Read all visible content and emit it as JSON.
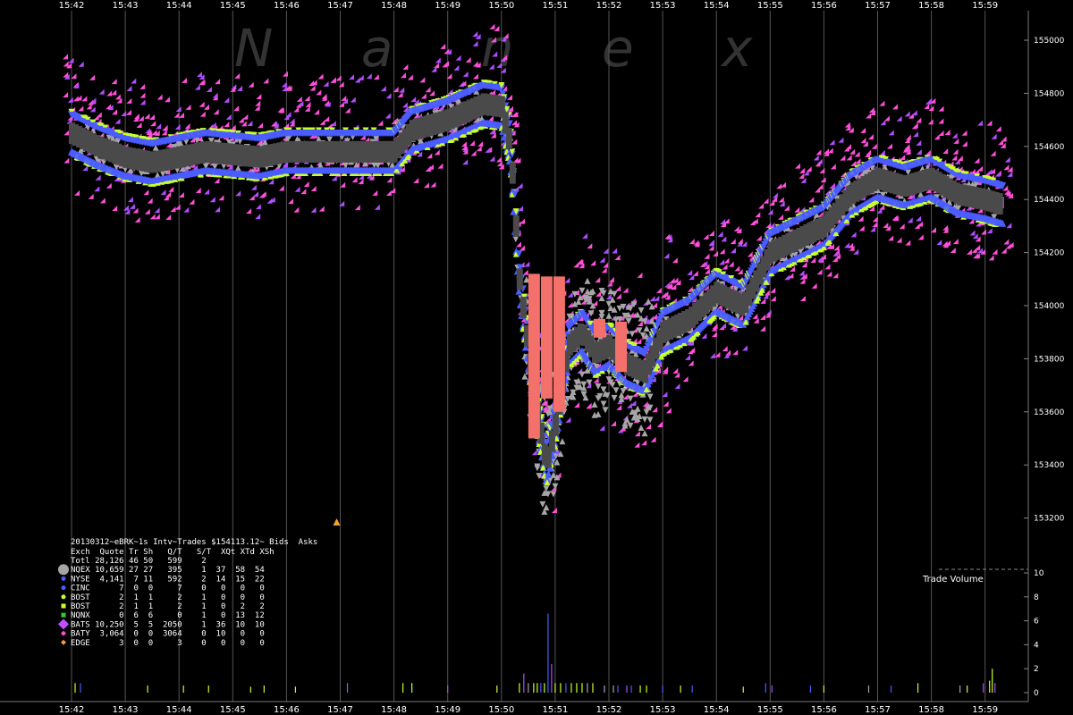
{
  "watermark": "N a n e x",
  "chart_data": [
    {
      "type": "scatter",
      "title": "20130312~eBRK~1s Intv~Trades $154113.12~ Bids  Asks",
      "x_ticks": [
        "15:42",
        "15:43",
        "15:44",
        "15:45",
        "15:46",
        "15:47",
        "15:48",
        "15:49",
        "15:50",
        "15:51",
        "15:52",
        "15:53",
        "15:54",
        "15:55",
        "15:56",
        "15:57",
        "15:58",
        "15:59"
      ],
      "y_ticks": [
        "155000",
        "154800",
        "154600",
        "154400",
        "154200",
        "154000",
        "153800",
        "153600",
        "153400",
        "153200"
      ],
      "ylim": [
        153050,
        155050
      ],
      "grid": true,
      "series_colors": {
        "nqex": "#a6a6a6",
        "nyse": "#4a5cff",
        "bats": "#ff4fd8",
        "baty": "#b04dff",
        "bost": "#c8ff2e",
        "trades": "#4a4a4a",
        "large_trade": "#f4706a",
        "edge": "#f0a030"
      },
      "bid_path": [
        [
          "15:42:00",
          154650
        ],
        [
          "15:42:30",
          154600
        ],
        [
          "15:43:00",
          154560
        ],
        [
          "15:43:30",
          154540
        ],
        [
          "15:44:00",
          154560
        ],
        [
          "15:44:30",
          154580
        ],
        [
          "15:45:00",
          154570
        ],
        [
          "15:45:30",
          154560
        ],
        [
          "15:46:00",
          154580
        ],
        [
          "15:47:00",
          154580
        ],
        [
          "15:48:00",
          154580
        ],
        [
          "15:48:20",
          154660
        ],
        [
          "15:49:00",
          154700
        ],
        [
          "15:49:40",
          154760
        ],
        [
          "15:50:00",
          154750
        ],
        [
          "15:50:10",
          154600
        ],
        [
          "15:50:20",
          154100
        ],
        [
          "15:50:35",
          153700
        ],
        [
          "15:50:50",
          153400
        ],
        [
          "15:51:00",
          153550
        ],
        [
          "15:51:15",
          153850
        ],
        [
          "15:51:30",
          153900
        ],
        [
          "15:51:45",
          153820
        ],
        [
          "15:52:00",
          153850
        ],
        [
          "15:52:20",
          153780
        ],
        [
          "15:52:40",
          153750
        ],
        [
          "15:53:00",
          153900
        ],
        [
          "15:53:30",
          153950
        ],
        [
          "15:54:00",
          154050
        ],
        [
          "15:54:30",
          154000
        ],
        [
          "15:55:00",
          154200
        ],
        [
          "15:55:30",
          154250
        ],
        [
          "15:56:00",
          154300
        ],
        [
          "15:56:30",
          154420
        ],
        [
          "15:57:00",
          154480
        ],
        [
          "15:57:30",
          154450
        ],
        [
          "15:58:00",
          154480
        ],
        [
          "15:58:30",
          154420
        ],
        [
          "15:59:00",
          154400
        ],
        [
          "15:59:20",
          154380
        ]
      ],
      "large_trades": [
        {
          "x": "15:50:36",
          "high": 154120,
          "low": 153500
        },
        {
          "x": "15:50:50",
          "high": 154110,
          "low": 153650
        },
        {
          "x": "15:51:04",
          "high": 154110,
          "low": 153600
        },
        {
          "x": "15:51:49",
          "high": 153950,
          "low": 153880
        },
        {
          "x": "15:52:13",
          "high": 153940,
          "low": 153750
        }
      ]
    },
    {
      "type": "bar",
      "title": "Trade Volume",
      "y_ticks": [
        "0",
        "2",
        "4",
        "6",
        "8",
        "10"
      ],
      "ylim": [
        0,
        10
      ],
      "bars": [
        {
          "x": "15:42:04",
          "v": 0.8,
          "c": "#c8ff2e"
        },
        {
          "x": "15:42:10",
          "v": 0.8,
          "c": "#4a5cff"
        },
        {
          "x": "15:43:25",
          "v": 0.6,
          "c": "#c8ff2e"
        },
        {
          "x": "15:44:05",
          "v": 0.6,
          "c": "#c8ff2e"
        },
        {
          "x": "15:44:33",
          "v": 0.6,
          "c": "#c8ff2e"
        },
        {
          "x": "15:45:20",
          "v": 0.5,
          "c": "#c8ff2e"
        },
        {
          "x": "15:45:35",
          "v": 0.6,
          "c": "#c8ff2e"
        },
        {
          "x": "15:46:10",
          "v": 0.5,
          "c": "#c8ff2e"
        },
        {
          "x": "15:47:08",
          "v": 0.8,
          "c": "#b04dff"
        },
        {
          "x": "15:48:10",
          "v": 0.8,
          "c": "#c8ff2e"
        },
        {
          "x": "15:48:20",
          "v": 0.8,
          "c": "#c8ff2e"
        },
        {
          "x": "15:49:00",
          "v": 0.6,
          "c": "#b04dff"
        },
        {
          "x": "15:49:55",
          "v": 0.6,
          "c": "#c8ff2e"
        },
        {
          "x": "15:50:20",
          "v": 0.8,
          "c": "#c8ff2e"
        },
        {
          "x": "15:50:25",
          "v": 1.6,
          "c": "#b04dff"
        },
        {
          "x": "15:50:30",
          "v": 0.8,
          "c": "#a6a6a6"
        },
        {
          "x": "15:50:36",
          "v": 0.8,
          "c": "#c8ff2e"
        },
        {
          "x": "15:50:40",
          "v": 0.8,
          "c": "#c8ff2e"
        },
        {
          "x": "15:50:44",
          "v": 0.8,
          "c": "#4a5cff"
        },
        {
          "x": "15:50:48",
          "v": 0.8,
          "c": "#c8ff2e"
        },
        {
          "x": "15:50:52",
          "v": 6.6,
          "c": "#4a5cff"
        },
        {
          "x": "15:50:56",
          "v": 2.4,
          "c": "#b04dff"
        },
        {
          "x": "15:51:00",
          "v": 0.8,
          "c": "#c8ff2e"
        },
        {
          "x": "15:51:06",
          "v": 0.8,
          "c": "#c8ff2e"
        },
        {
          "x": "15:51:12",
          "v": 0.8,
          "c": "#4a5cff"
        },
        {
          "x": "15:51:18",
          "v": 0.8,
          "c": "#c8ff2e"
        },
        {
          "x": "15:51:24",
          "v": 0.8,
          "c": "#c8ff2e"
        },
        {
          "x": "15:51:30",
          "v": 0.8,
          "c": "#c8ff2e"
        },
        {
          "x": "15:51:36",
          "v": 0.8,
          "c": "#a6a6a6"
        },
        {
          "x": "15:51:42",
          "v": 0.8,
          "c": "#c8ff2e"
        },
        {
          "x": "15:51:55",
          "v": 0.6,
          "c": "#a6a6a6"
        },
        {
          "x": "15:52:05",
          "v": 0.6,
          "c": "#a6a6a6"
        },
        {
          "x": "15:52:10",
          "v": 0.6,
          "c": "#4a5cff"
        },
        {
          "x": "15:52:20",
          "v": 0.6,
          "c": "#b04dff"
        },
        {
          "x": "15:52:25",
          "v": 0.6,
          "c": "#4a5cff"
        },
        {
          "x": "15:52:35",
          "v": 0.6,
          "c": "#c8ff2e"
        },
        {
          "x": "15:52:42",
          "v": 0.6,
          "c": "#c8ff2e"
        },
        {
          "x": "15:53:00",
          "v": 0.6,
          "c": "#4a5cff"
        },
        {
          "x": "15:53:20",
          "v": 0.6,
          "c": "#c8ff2e"
        },
        {
          "x": "15:53:33",
          "v": 0.6,
          "c": "#4a5cff"
        },
        {
          "x": "15:54:30",
          "v": 0.5,
          "c": "#c8ff2e"
        },
        {
          "x": "15:54:55",
          "v": 0.8,
          "c": "#4a5cff"
        },
        {
          "x": "15:55:02",
          "v": 0.6,
          "c": "#b04dff"
        },
        {
          "x": "15:55:45",
          "v": 0.6,
          "c": "#4a5cff"
        },
        {
          "x": "15:56:00",
          "v": 0.6,
          "c": "#c8ff2e"
        },
        {
          "x": "15:56:50",
          "v": 0.6,
          "c": "#a6a6a6"
        },
        {
          "x": "15:57:15",
          "v": 0.6,
          "c": "#4a5cff"
        },
        {
          "x": "15:57:45",
          "v": 0.8,
          "c": "#c8ff2e"
        },
        {
          "x": "15:58:32",
          "v": 0.6,
          "c": "#a6a6a6"
        },
        {
          "x": "15:58:40",
          "v": 0.6,
          "c": "#c8ff2e"
        },
        {
          "x": "15:58:58",
          "v": 0.8,
          "c": "#b04dff"
        },
        {
          "x": "15:59:05",
          "v": 1.0,
          "c": "#c8ff2e"
        },
        {
          "x": "15:59:08",
          "v": 2.0,
          "c": "#c8ff2e"
        },
        {
          "x": "15:59:11",
          "v": 0.8,
          "c": "#b04dff"
        }
      ]
    }
  ],
  "legend": {
    "title": "20130312~eBRK~1s Intv~Trades $154113.12~ Bids  Asks",
    "header": "Exch  Quote Tr Sh   Q/T   S/T  XQt XTd XSh",
    "rows": [
      {
        "text": "Totl 28,126 46 50   599    2",
        "marker": "none",
        "color": ""
      },
      {
        "text": "NQEX 10,659 27 27   395    1  37  58  54",
        "marker": "big-circle",
        "color": "#a6a6a6"
      },
      {
        "text": "NYSE  4,141  7 11   592    2  14  15  22",
        "marker": "circle",
        "color": "#4a5cff"
      },
      {
        "text": "CINC      7  0  0     7    0   0   0   0",
        "marker": "circle",
        "color": "#4a5cff"
      },
      {
        "text": "BOST      2  1  1     2    1   0   0   0",
        "marker": "circle",
        "color": "#c8ff2e"
      },
      {
        "text": "BOST      2  1  1     2    1   0   2   2",
        "marker": "square",
        "color": "#c8ff2e"
      },
      {
        "text": "NQNX      0  6  6     0    1   0  13  12",
        "marker": "square",
        "color": "#2ecc40"
      },
      {
        "text": "BATS 10,250  5  5  2050    1  36  10  10",
        "marker": "big-diamond",
        "color": "#c050ff"
      },
      {
        "text": "BATY  3,064  0  0  3064    0  10   0   0",
        "marker": "diamond",
        "color": "#ff4fd8"
      },
      {
        "text": "EDGE      3  0  0     3    0   0   0   0",
        "marker": "diamond",
        "color": "#f0a030"
      }
    ]
  }
}
